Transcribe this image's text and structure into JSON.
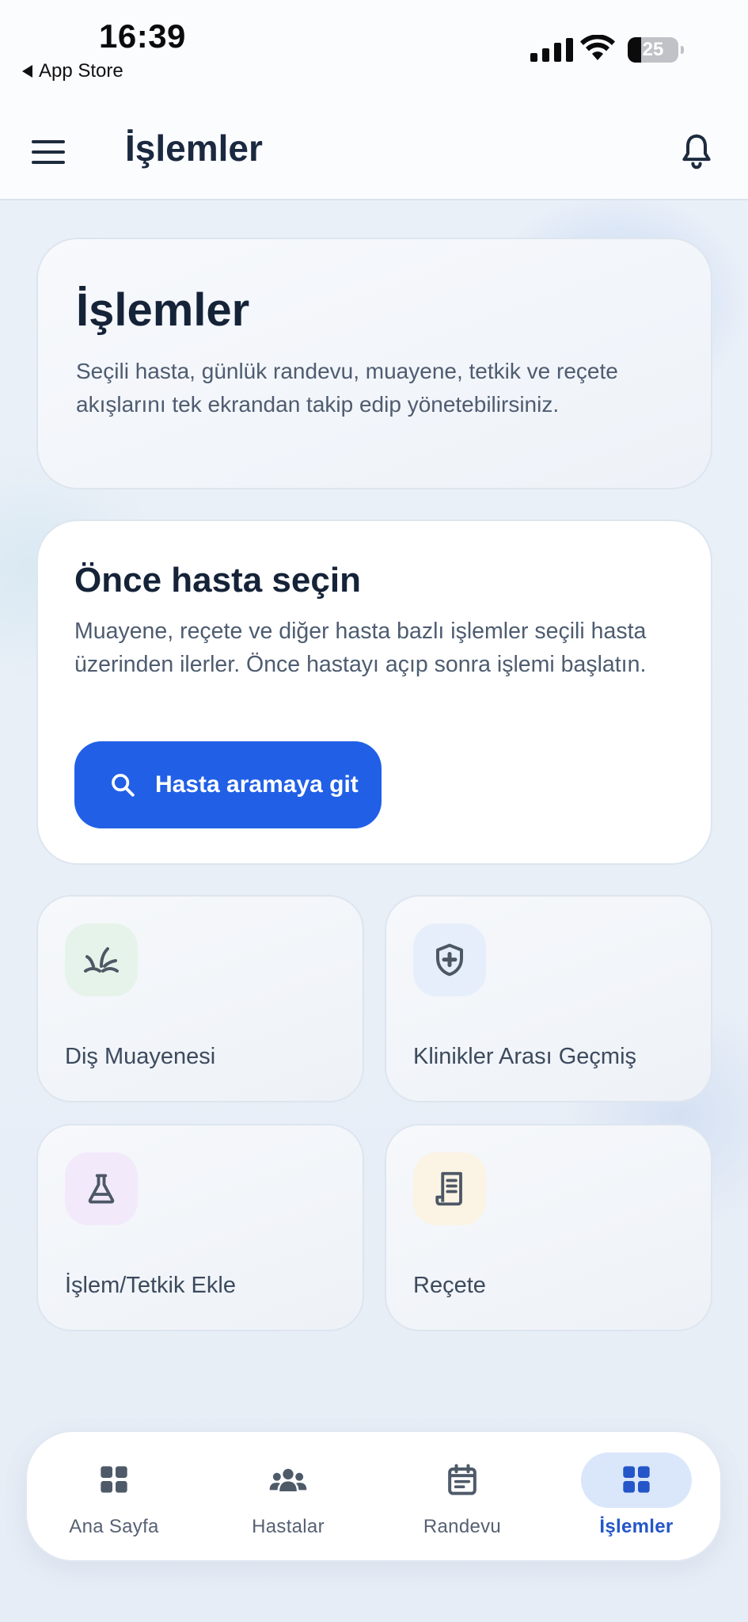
{
  "status_bar": {
    "time": "16:39",
    "back_app": "App Store",
    "battery_level": "25"
  },
  "header": {
    "title": "İşlemler",
    "menu_icon": "hamburger-menu-icon",
    "notification_icon": "bell-icon"
  },
  "hero": {
    "title": "İşlemler",
    "description": "Seçili hasta, günlük randevu, muayene, tetkik ve reçete akışlarını tek ekrandan takip edip yönetebilirsiniz."
  },
  "patient_select": {
    "title": "Önce hasta seçin",
    "description": "Muayene, reçete ve diğer hasta bazlı işlemler seçili hasta üzerinden ilerler. Önce hastayı açıp sonra işlemi başlatın.",
    "button_label": "Hasta aramaya git",
    "button_icon": "search-icon",
    "button_color": "#2160e6"
  },
  "actions": [
    {
      "label": "Diş Muayenesi",
      "icon": "tooth-icon",
      "icon_bg": "#e6f3ea",
      "icon_color": "#4d5866"
    },
    {
      "label": "Klinikler Arası Geçmiş",
      "icon": "shield-plus-icon",
      "icon_bg": "#e6eefb",
      "icon_color": "#4d5866"
    },
    {
      "label": "İşlem/Tetkik Ekle",
      "icon": "flask-icon",
      "icon_bg": "#f2e9fb",
      "icon_color": "#4d5866"
    },
    {
      "label": "Reçete",
      "icon": "receipt-icon",
      "icon_bg": "#fbf3e4",
      "icon_color": "#4d5866"
    }
  ],
  "bottom_nav": {
    "items": [
      {
        "label": "Ana Sayfa",
        "icon": "grid-icon"
      },
      {
        "label": "Hastalar",
        "icon": "users-icon"
      },
      {
        "label": "Randevu",
        "icon": "calendar-icon"
      },
      {
        "label": "İşlemler",
        "icon": "grid-icon"
      }
    ],
    "active_index": 3,
    "active_color": "#2456c9"
  }
}
